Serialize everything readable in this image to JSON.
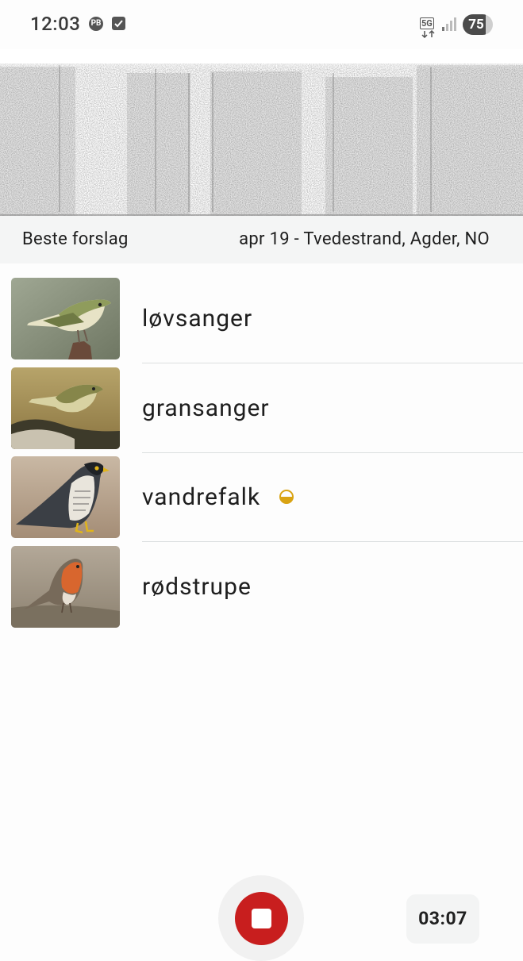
{
  "status_bar": {
    "time": "12:03",
    "notification_icons": [
      "pb-icon",
      "checkbox-icon"
    ],
    "network": "5G",
    "battery": "75",
    "battery_level": 0.75
  },
  "header": {
    "title": "Beste forslag",
    "meta": "apr 19 - Tvedestrand, Agder, NO"
  },
  "results": [
    {
      "name": "løvsanger",
      "image": "willow-warbler-photo",
      "badge": null
    },
    {
      "name": "gransanger",
      "image": "chiffchaff-photo",
      "badge": null
    },
    {
      "name": "vandrefalk",
      "image": "peregrine-falcon-photo",
      "badge": "half-circle-icon"
    },
    {
      "name": "rødstrupe",
      "image": "robin-photo",
      "badge": null
    }
  ],
  "controls": {
    "record_button": "stop-icon",
    "timer": "03:07",
    "accent": "#c81e1e",
    "badge_color": "#d9a313"
  }
}
